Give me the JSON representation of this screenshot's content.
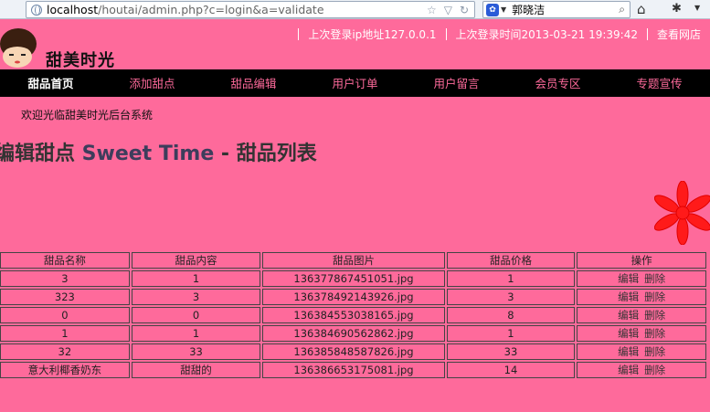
{
  "browser": {
    "url_host": "localhost",
    "url_path": "/houtai/admin.php?c=login&a=validate",
    "search_query": "郭晓洁"
  },
  "header": {
    "brand": "甜美时光",
    "last_ip_label": "上次登录ip地址127.0.0.1",
    "last_time_label": "上次登录时间2013-03-21 19:39:42",
    "view_site": "查看网店"
  },
  "nav": {
    "items": [
      {
        "label": "甜品首页",
        "active": true
      },
      {
        "label": "添加甜点"
      },
      {
        "label": "甜品编辑"
      },
      {
        "label": "用户订单"
      },
      {
        "label": "用户留言"
      },
      {
        "label": "会员专区"
      },
      {
        "label": "专题宣传"
      }
    ]
  },
  "welcome": "欢迎光临甜美时光后台系统",
  "title": {
    "part1": "编辑甜点 ",
    "part2": "Sweet Time",
    "part3": " - 甜品列表"
  },
  "table": {
    "headers": [
      "甜品名称",
      "甜品内容",
      "甜品图片",
      "甜品价格",
      "操作"
    ],
    "edit_label": "编辑",
    "delete_label": "删除",
    "rows": [
      [
        "3",
        "1",
        "136377867451051.jpg",
        "1"
      ],
      [
        "323",
        "3",
        "136378492143926.jpg",
        "3"
      ],
      [
        "0",
        "0",
        "136384553038165.jpg",
        "8"
      ],
      [
        "1",
        "1",
        "136384690562862.jpg",
        "1"
      ],
      [
        "32",
        "33",
        "136385848587826.jpg",
        "33"
      ],
      [
        "意大利椰香奶东",
        "甜甜的",
        "136386653175081.jpg",
        "14"
      ]
    ]
  },
  "colors": {
    "background": "#fe6a9b",
    "nav_bg": "#000000",
    "flower": "#ff0000"
  }
}
